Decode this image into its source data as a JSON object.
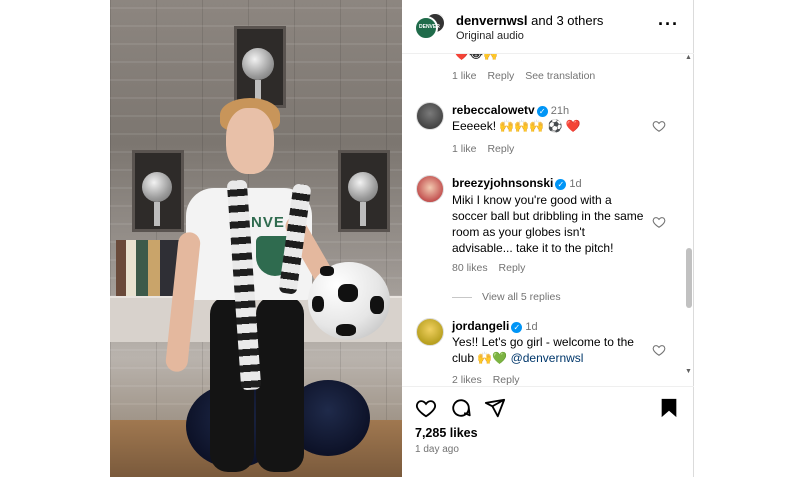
{
  "header": {
    "username": "denvernwsl",
    "others": " and 3 others",
    "audio": "Original audio",
    "more": "···",
    "avatar_text": "DENVER"
  },
  "comments": {
    "partial_emojis": "❤️😂🙌",
    "first_meta": {
      "likes": "1 like",
      "reply": "Reply",
      "translate": "See translation"
    },
    "items": [
      {
        "user": "rebeccalowetv",
        "verified": "✓",
        "time": "21h",
        "text": "Eeeeek! 🙌🙌🙌 ⚽ ❤️",
        "likes": "1 like",
        "reply": "Reply"
      },
      {
        "user": "breezyjohnsonski",
        "verified": "✓",
        "time": "1d",
        "text": "Miki I know you're good with a soccer ball but dribbling in the same room as your globes isn't advisable... take it to the pitch!",
        "likes": "80 likes",
        "reply": "Reply"
      },
      {
        "user": "jordangeli",
        "verified": "✓",
        "time": "1d",
        "text_before": "Yes!! Let's go girl - welcome to the club 🙌💚 ",
        "mention": "@denvernwsl",
        "likes": "2 likes",
        "reply": "Reply"
      }
    ],
    "view_replies": "View all 5 replies"
  },
  "footer": {
    "likes": "7,285 likes",
    "time_ago": "1 day ago"
  },
  "colors": {
    "verified": "#0095f6",
    "mention": "#00376b",
    "meta": "#737373"
  },
  "icons": [
    "heart-icon",
    "comment-icon",
    "share-icon",
    "bookmark-icon",
    "more-icon"
  ]
}
